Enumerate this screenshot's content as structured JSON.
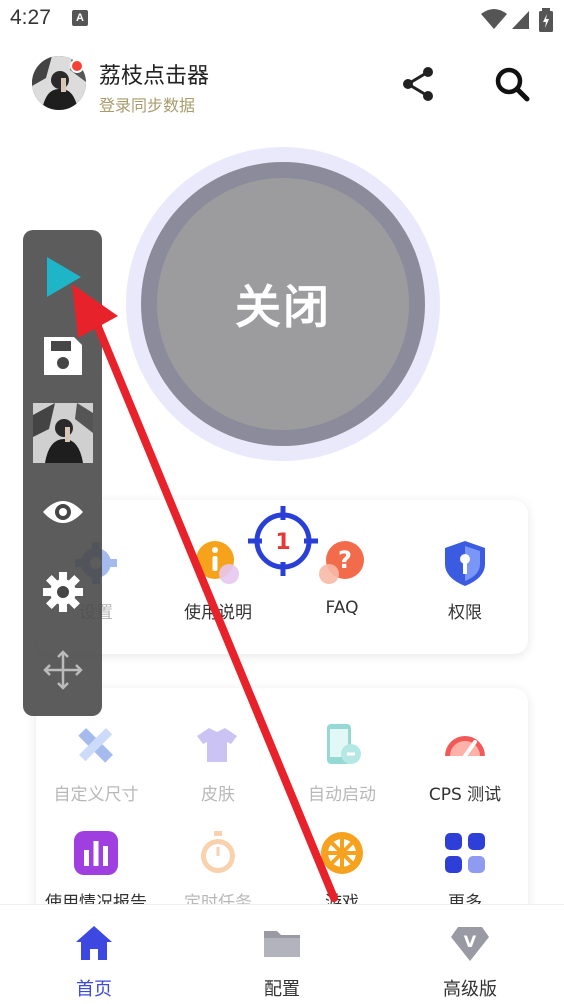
{
  "status_bar": {
    "time": "4:27",
    "sim_label": "A"
  },
  "header": {
    "title": "荔枝点击器",
    "subtitle": "登录同步数据"
  },
  "main_button": {
    "label": "关闭"
  },
  "card1": {
    "items": [
      {
        "label": "设置",
        "icon": "gear-icon"
      },
      {
        "label": "使用说明",
        "icon": "info-icon"
      },
      {
        "label": "FAQ",
        "icon": "question-icon"
      },
      {
        "label": "权限",
        "icon": "shield-key-icon"
      }
    ]
  },
  "card2": {
    "items": [
      {
        "label": "自定义尺寸",
        "icon": "ruler-pencil-icon"
      },
      {
        "label": "皮肤",
        "icon": "tshirt-icon"
      },
      {
        "label": "自动启动",
        "icon": "phone-link-icon"
      },
      {
        "label": "CPS 测试",
        "icon": "speedometer-icon"
      },
      {
        "label": "使用情况报告",
        "icon": "bar-chart-icon"
      },
      {
        "label": "定时任务",
        "icon": "stopwatch-icon"
      },
      {
        "label": "游戏",
        "icon": "wheel-icon"
      },
      {
        "label": "更多",
        "icon": "grid-icon"
      }
    ]
  },
  "target": {
    "number": "1"
  },
  "bottom_nav": {
    "items": [
      {
        "label": "首页",
        "icon": "home-icon",
        "active": true
      },
      {
        "label": "配置",
        "icon": "folder-icon",
        "active": false
      },
      {
        "label": "高级版",
        "icon": "vip-diamond-icon",
        "active": false
      }
    ]
  },
  "floating_toolbar": {
    "items": [
      "play-icon",
      "save-icon",
      "avatar-thumbnail",
      "eye-icon",
      "gear-icon",
      "move-icon"
    ]
  },
  "colors": {
    "accent": "#3c48e0",
    "play": "#1fb5c9",
    "target": "#2a3fd6",
    "target_badge": "#e53935",
    "arrow": "#e8222a",
    "subtitle": "#a89b6c"
  }
}
